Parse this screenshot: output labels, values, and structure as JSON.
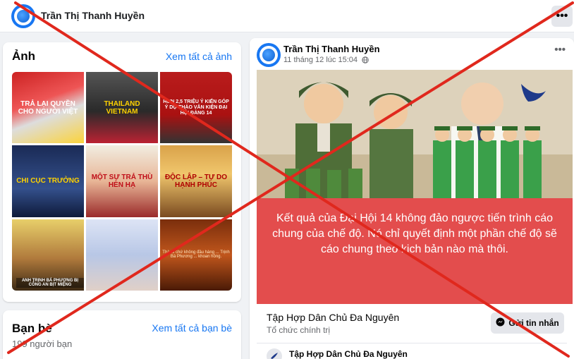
{
  "header": {
    "profile_name": "Trần Thị Thanh Huyền",
    "more": "•••"
  },
  "photos": {
    "title": "Ảnh",
    "see_all": "Xem tất cả ảnh",
    "tiles": [
      {
        "caption": "TRẢ LẠI QUYỀN CHO NGƯỜI VIỆT"
      },
      {
        "caption": "THAILAND VIETNAM"
      },
      {
        "caption": "HƠN 2,5 TRIỆU Ý KIẾN GÓP Ý DỰ THẢO VĂN KIỆN ĐẠI HỘI ĐẢNG 14"
      },
      {
        "caption": "CHI CỤC TRƯỞNG"
      },
      {
        "caption": "MỘT SỰ TRẢ THÙ HÈN HẠ"
      },
      {
        "caption": "ĐỘC LẬP – TỰ DO HẠNH PHÚC"
      },
      {
        "caption": "",
        "tag": "ANH TRỊNH BÁ PHƯƠNG BỊ CÔNG AN BỊT MIỆNG"
      },
      {
        "caption": ""
      },
      {
        "caption": "Thà tù chứ không đầu hàng ... Trịnh Bá Phương ... khoan hồng."
      }
    ]
  },
  "friends": {
    "title": "Bạn bè",
    "see_all": "Xem tất cả bạn bè",
    "count": "199 người bạn"
  },
  "post": {
    "author": "Trần Thị Thanh Huyền",
    "timestamp": "11 tháng 12 lúc 15:04",
    "privacy_icon": "globe-icon",
    "banner_caption": "Kết quả của Đại Hội 14 không đảo ngược tiến trình cáo chung của chế độ. Nó chỉ quyết định một phần chế độ sẽ cáo chung theo kịch bản nào mà thôi.",
    "page_name": "Tập Hợp Dân Chủ Đa Nguyên",
    "page_category": "Tổ chức chính trị",
    "message_button": "Gửi tin nhắn",
    "shared_name": "Tập Hợp Dân Chủ Đa Nguyên"
  },
  "colors": {
    "facebook_blue": "#1877f2",
    "banner_red": "#e34d4d",
    "cross_red": "#e0281d"
  }
}
